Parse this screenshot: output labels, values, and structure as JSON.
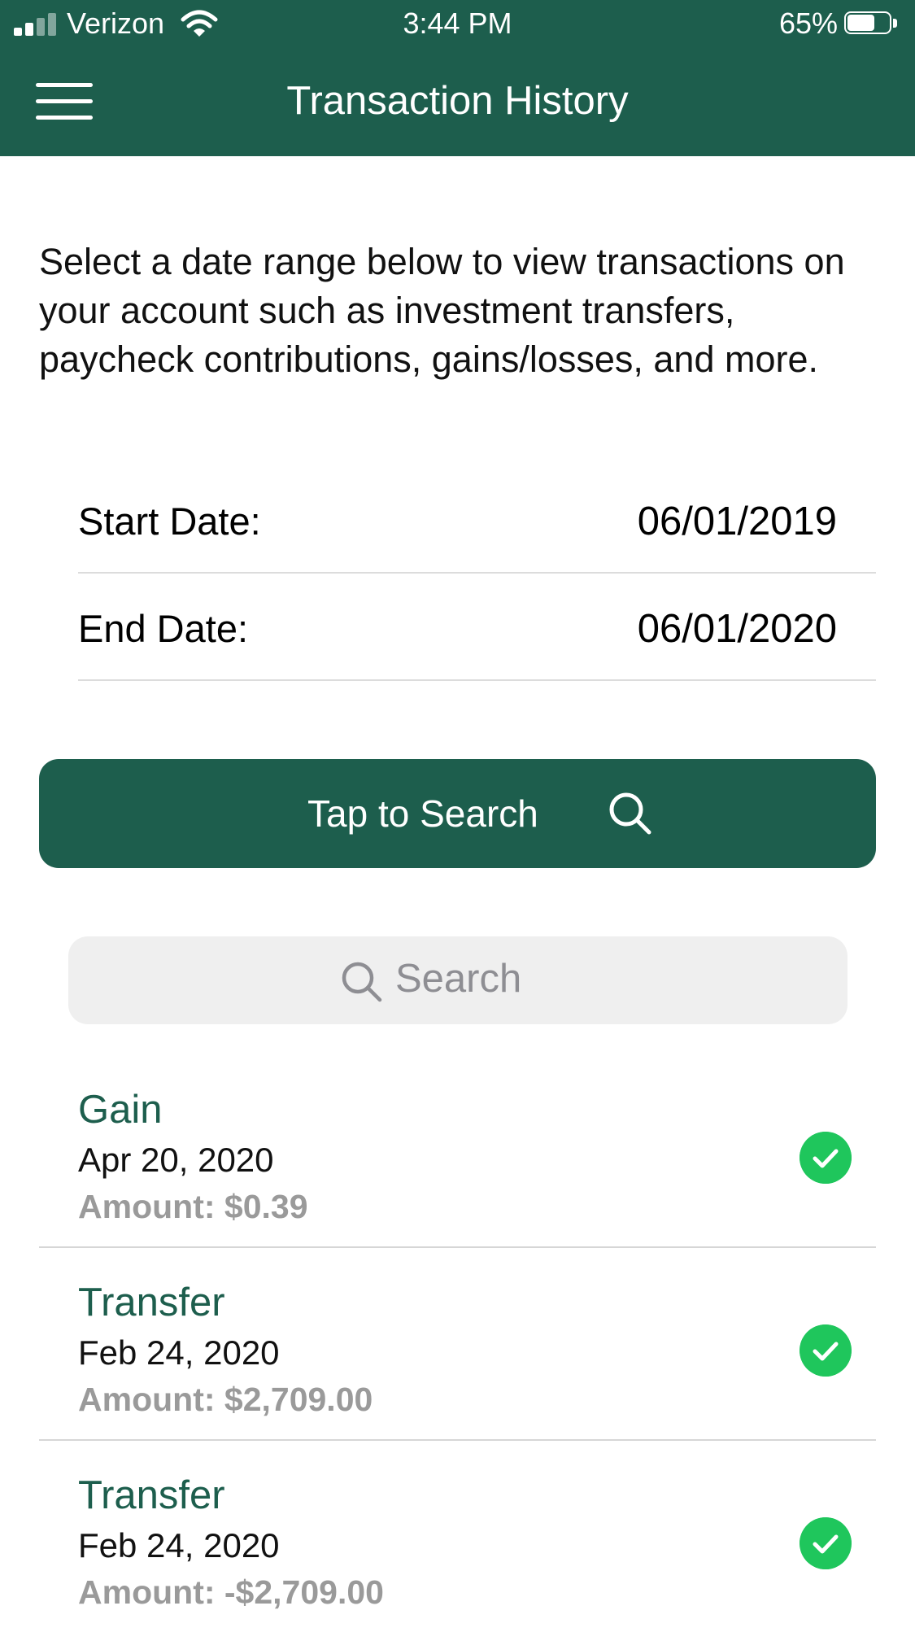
{
  "status_bar": {
    "carrier": "Verizon",
    "time": "3:44 PM",
    "battery_percent": "65%",
    "battery_level": 0.65
  },
  "header": {
    "title": "Transaction History",
    "color": "#1d5e4d"
  },
  "intro_text": "Select a date range below to view transactions on your account such as investment transfers, paycheck contributions, gains/losses, and more.",
  "date_range": {
    "start_label": "Start Date:",
    "start_value": "06/01/2019",
    "end_label": "End Date:",
    "end_value": "06/01/2020"
  },
  "search_button": {
    "label": "Tap to Search",
    "icon": "search-icon"
  },
  "search": {
    "placeholder": "Search",
    "icon": "search-icon"
  },
  "transactions": [
    {
      "type": "Gain",
      "date": "Apr 20, 2020",
      "amount": "Amount: $0.39",
      "status_icon": "check-circle-icon"
    },
    {
      "type": "Transfer",
      "date": "Feb 24, 2020",
      "amount": "Amount: $2,709.00",
      "status_icon": "check-circle-icon"
    },
    {
      "type": "Transfer",
      "date": "Feb 24, 2020",
      "amount": "Amount: -$2,709.00",
      "status_icon": "check-circle-icon"
    }
  ],
  "colors": {
    "accent": "#1d5e4d",
    "success": "#1fc65c"
  }
}
